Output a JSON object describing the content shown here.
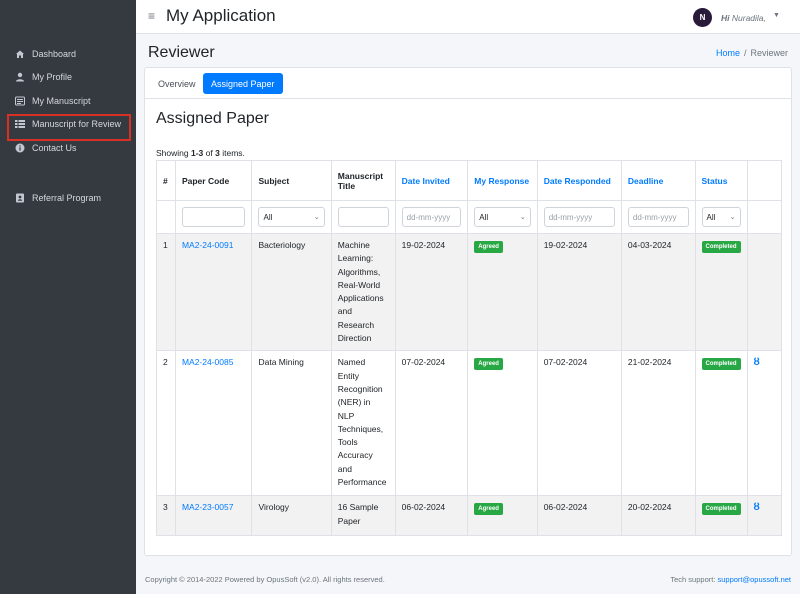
{
  "sidebar": {
    "items": [
      {
        "label": "Dashboard",
        "icon": "home-icon"
      },
      {
        "label": "My Profile",
        "icon": "user-icon"
      },
      {
        "label": "My Manuscript",
        "icon": "list-alt-icon"
      },
      {
        "label": "Manuscript for Review",
        "icon": "list-icon"
      },
      {
        "label": "Contact Us",
        "icon": "info-circle-icon"
      }
    ],
    "referral": {
      "label": "Referral Program",
      "icon": "address-book-icon"
    }
  },
  "topbar": {
    "app_title": "My Application",
    "avatar_initial": "N",
    "greeting": "Hi",
    "user_name": "Nuradila,"
  },
  "page": {
    "title": "Reviewer",
    "breadcrumb": {
      "home": "Home",
      "separator": "/",
      "current": "Reviewer"
    }
  },
  "tabs": [
    {
      "label": "Overview",
      "active": false
    },
    {
      "label": "Assigned Paper",
      "active": true
    }
  ],
  "section_title": "Assigned Paper",
  "summary": {
    "prefix": "Showing",
    "range": "1-3",
    "of": "of",
    "total": "3",
    "suffix": "items."
  },
  "table": {
    "headers": [
      "#",
      "Paper Code",
      "Subject",
      "Manuscript Title",
      "Date Invited",
      "My Response",
      "Date Responded",
      "Deadline",
      "Status"
    ],
    "filters": {
      "subject": "All",
      "date_invited_placeholder": "dd-mm-yyyy",
      "my_response": "All",
      "date_responded_placeholder": "dd-mm-yyyy",
      "deadline_placeholder": "dd-mm-yyyy",
      "status": "All"
    },
    "rows": [
      {
        "num": "1",
        "code": "MA2-24-0091",
        "subject": "Bacteriology",
        "title": "Machine Learning: Algorithms, Real-World Applications and Research Direction",
        "invited": "19-02-2024",
        "response": "Agreed",
        "responded": "19-02-2024",
        "deadline": "04-03-2024",
        "status": "Completed",
        "action": ""
      },
      {
        "num": "2",
        "code": "MA2-24-0085",
        "subject": "Data Mining",
        "title": "Named Entity Recognition (NER) in NLP Techniques, Tools Accuracy and Performance",
        "invited": "07-02-2024",
        "response": "Agreed",
        "responded": "07-02-2024",
        "deadline": "21-02-2024",
        "status": "Completed",
        "action": "ȣ"
      },
      {
        "num": "3",
        "code": "MA2-23-0057",
        "subject": "Virology",
        "title": "16 Sample Paper",
        "invited": "06-02-2024",
        "response": "Agreed",
        "responded": "06-02-2024",
        "deadline": "20-02-2024",
        "status": "Completed",
        "action": "ȣ"
      }
    ]
  },
  "footer": {
    "copyright": "Copyright © 2014-2022 Powered by OpusSoft (v2.0). All rights reserved.",
    "support_label": "Tech support:",
    "support_email": "support@opussoft.net"
  },
  "colors": {
    "sidebar_bg": "#343a40",
    "primary": "#007bff",
    "success": "#28a745",
    "highlight_border": "#d93025"
  }
}
